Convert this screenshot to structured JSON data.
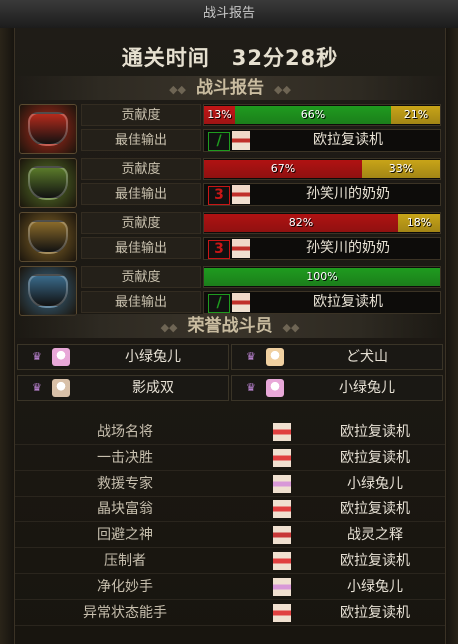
{
  "window": {
    "title": "战斗报告"
  },
  "clear_time": "通关时间　32分28秒",
  "battle_report": {
    "header": "战斗报告",
    "contribution_label": "贡献度",
    "best_output_label": "最佳输出",
    "rows": [
      {
        "icon": "red-demon-mask-icon",
        "mask_color": "#b52b1c",
        "segments": [
          {
            "label": "13%",
            "value": 13,
            "color": "#c21616"
          },
          {
            "label": "66%",
            "value": 66,
            "color": "#1f9b1f"
          },
          {
            "label": "21%",
            "value": 21,
            "color": "#c8a418"
          }
        ],
        "job_icon": "green-slash-icon",
        "job_glyph": "/",
        "job_color": "#1f9b1f",
        "best_player": "欧拉复读机"
      },
      {
        "icon": "green-spiked-mask-icon",
        "mask_color": "#5a7a2a",
        "segments": [
          {
            "label": "67%",
            "value": 67,
            "color": "#b01212"
          },
          {
            "label": "33%",
            "value": 33,
            "color": "#c8a418"
          }
        ],
        "job_icon": "red-three-icon",
        "job_glyph": "3",
        "job_color": "#c81616",
        "best_player": "孙笑川的奶奶"
      },
      {
        "icon": "gold-horned-mask-icon",
        "mask_color": "#8a6a2a",
        "segments": [
          {
            "label": "82%",
            "value": 82,
            "color": "#b01212"
          },
          {
            "label": "18%",
            "value": 18,
            "color": "#c8a418"
          }
        ],
        "job_icon": "red-three-icon",
        "job_glyph": "3",
        "job_color": "#c81616",
        "best_player": "孙笑川的奶奶"
      },
      {
        "icon": "blue-crystal-mask-icon",
        "mask_color": "#3a6a8a",
        "segments": [
          {
            "label": "100%",
            "value": 100,
            "color": "#1f9b1f"
          }
        ],
        "job_icon": "green-slash-icon",
        "job_glyph": "/",
        "job_color": "#1f9b1f",
        "best_player": "欧拉复读机"
      }
    ]
  },
  "honor": {
    "header": "荣誉战斗员",
    "members": [
      {
        "name": "小绿兔儿",
        "avatar_color": "#e8a8d8"
      },
      {
        "name": "ど犬山",
        "avatar_color": "#f0d0a0"
      },
      {
        "name": "影成双",
        "avatar_color": "#d8c0a8"
      },
      {
        "name": "小绿兔儿",
        "avatar_color": "#e8a8d8"
      }
    ]
  },
  "awards": [
    {
      "title": "战场名将",
      "player": "欧拉复读机",
      "avatar_color": "#e04040"
    },
    {
      "title": "一击决胜",
      "player": "欧拉复读机",
      "avatar_color": "#e04040"
    },
    {
      "title": "救援专家",
      "player": "小绿兔儿",
      "avatar_color": "#d898d8"
    },
    {
      "title": "晶块富翁",
      "player": "欧拉复读机",
      "avatar_color": "#e04040"
    },
    {
      "title": "回避之神",
      "player": "战灵之释",
      "avatar_color": "#c83838"
    },
    {
      "title": "压制者",
      "player": "欧拉复读机",
      "avatar_color": "#e04040"
    },
    {
      "title": "净化妙手",
      "player": "小绿兔儿",
      "avatar_color": "#d898d8"
    },
    {
      "title": "异常状态能手",
      "player": "欧拉复读机",
      "avatar_color": "#e04040"
    }
  ]
}
